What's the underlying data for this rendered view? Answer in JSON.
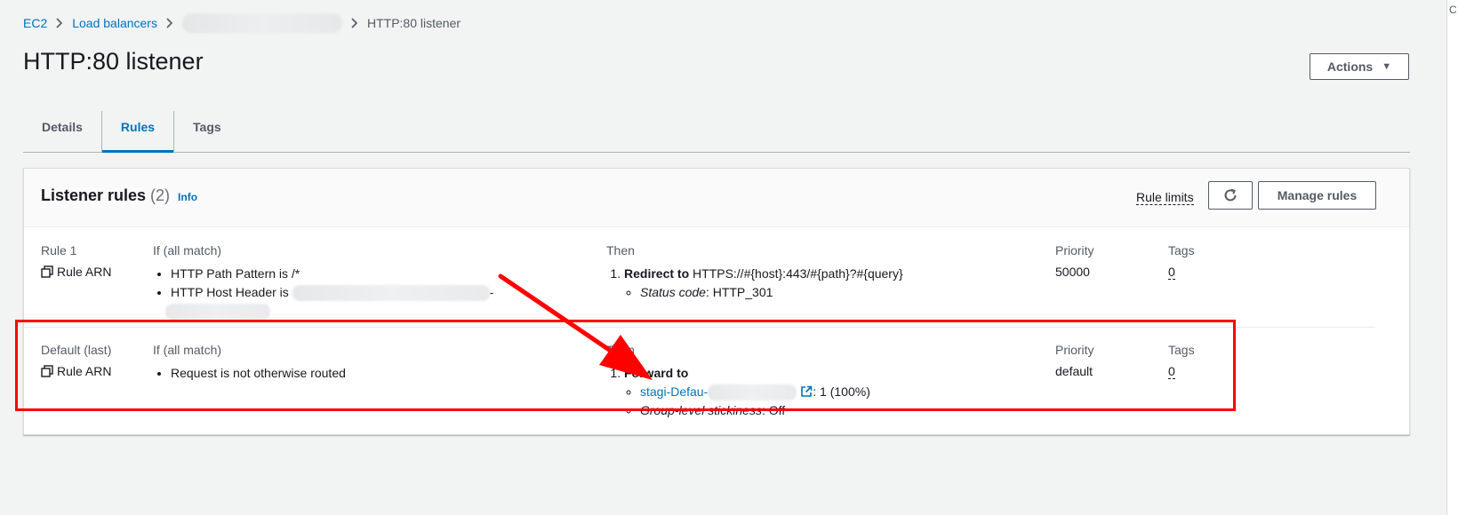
{
  "breadcrumb": {
    "items": [
      "EC2",
      "Load balancers"
    ],
    "current": "HTTP:80 listener"
  },
  "page": {
    "title": "HTTP:80 listener",
    "actions_label": "Actions"
  },
  "tabs": [
    {
      "label": "Details"
    },
    {
      "label": "Rules"
    },
    {
      "label": "Tags"
    }
  ],
  "active_tab": "Rules",
  "listener_rules": {
    "title": "Listener rules",
    "count": "(2)",
    "info": "Info",
    "rule_limits": "Rule limits",
    "manage_label": "Manage rules"
  },
  "columns": {
    "if": "If (all match)",
    "then": "Then",
    "priority": "Priority",
    "tags": "Tags"
  },
  "rules": [
    {
      "name": "Rule 1",
      "arn": "Rule ARN",
      "conditions": [
        "HTTP Path Pattern is /*",
        "HTTP Host Header is"
      ],
      "condition_tail": "-",
      "action_title": "Redirect to",
      "action_value": "HTTPS://#{host}:443/#{path}?#{query}",
      "detail_label": "Status code",
      "detail_value": ": HTTP_301",
      "priority": "50000",
      "tags": "0"
    },
    {
      "name": "Default (last)",
      "arn": "Rule ARN",
      "conditions": [
        "Request is not otherwise routed"
      ],
      "action_title": "Forward to",
      "target_group": "stagi-Defau-",
      "target_weight": ": 1 (100%)",
      "detail_label": "Group-level stickiness",
      "detail_value": ": Off",
      "priority": "default",
      "tags": "0"
    }
  ],
  "colors": {
    "link": "#0073bb",
    "annotation": "#ff0000",
    "background": "#f2f3f3"
  }
}
